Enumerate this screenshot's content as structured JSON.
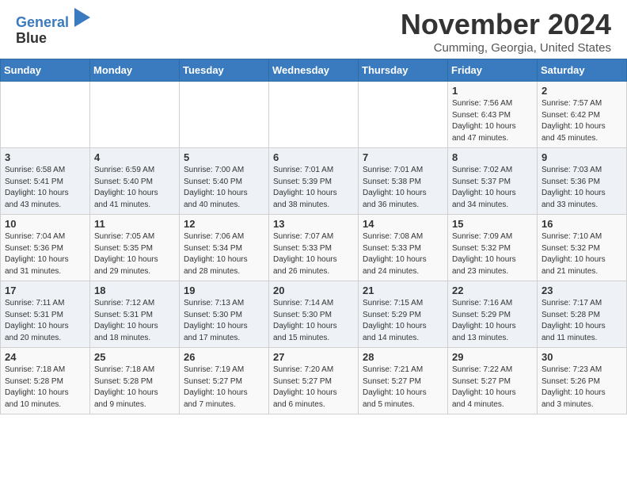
{
  "header": {
    "logo_line1": "General",
    "logo_line2": "Blue",
    "month": "November 2024",
    "location": "Cumming, Georgia, United States"
  },
  "days_of_week": [
    "Sunday",
    "Monday",
    "Tuesday",
    "Wednesday",
    "Thursday",
    "Friday",
    "Saturday"
  ],
  "weeks": [
    [
      {
        "day": "",
        "info": ""
      },
      {
        "day": "",
        "info": ""
      },
      {
        "day": "",
        "info": ""
      },
      {
        "day": "",
        "info": ""
      },
      {
        "day": "",
        "info": ""
      },
      {
        "day": "1",
        "info": "Sunrise: 7:56 AM\nSunset: 6:43 PM\nDaylight: 10 hours\nand 47 minutes."
      },
      {
        "day": "2",
        "info": "Sunrise: 7:57 AM\nSunset: 6:42 PM\nDaylight: 10 hours\nand 45 minutes."
      }
    ],
    [
      {
        "day": "3",
        "info": "Sunrise: 6:58 AM\nSunset: 5:41 PM\nDaylight: 10 hours\nand 43 minutes."
      },
      {
        "day": "4",
        "info": "Sunrise: 6:59 AM\nSunset: 5:40 PM\nDaylight: 10 hours\nand 41 minutes."
      },
      {
        "day": "5",
        "info": "Sunrise: 7:00 AM\nSunset: 5:40 PM\nDaylight: 10 hours\nand 40 minutes."
      },
      {
        "day": "6",
        "info": "Sunrise: 7:01 AM\nSunset: 5:39 PM\nDaylight: 10 hours\nand 38 minutes."
      },
      {
        "day": "7",
        "info": "Sunrise: 7:01 AM\nSunset: 5:38 PM\nDaylight: 10 hours\nand 36 minutes."
      },
      {
        "day": "8",
        "info": "Sunrise: 7:02 AM\nSunset: 5:37 PM\nDaylight: 10 hours\nand 34 minutes."
      },
      {
        "day": "9",
        "info": "Sunrise: 7:03 AM\nSunset: 5:36 PM\nDaylight: 10 hours\nand 33 minutes."
      }
    ],
    [
      {
        "day": "10",
        "info": "Sunrise: 7:04 AM\nSunset: 5:36 PM\nDaylight: 10 hours\nand 31 minutes."
      },
      {
        "day": "11",
        "info": "Sunrise: 7:05 AM\nSunset: 5:35 PM\nDaylight: 10 hours\nand 29 minutes."
      },
      {
        "day": "12",
        "info": "Sunrise: 7:06 AM\nSunset: 5:34 PM\nDaylight: 10 hours\nand 28 minutes."
      },
      {
        "day": "13",
        "info": "Sunrise: 7:07 AM\nSunset: 5:33 PM\nDaylight: 10 hours\nand 26 minutes."
      },
      {
        "day": "14",
        "info": "Sunrise: 7:08 AM\nSunset: 5:33 PM\nDaylight: 10 hours\nand 24 minutes."
      },
      {
        "day": "15",
        "info": "Sunrise: 7:09 AM\nSunset: 5:32 PM\nDaylight: 10 hours\nand 23 minutes."
      },
      {
        "day": "16",
        "info": "Sunrise: 7:10 AM\nSunset: 5:32 PM\nDaylight: 10 hours\nand 21 minutes."
      }
    ],
    [
      {
        "day": "17",
        "info": "Sunrise: 7:11 AM\nSunset: 5:31 PM\nDaylight: 10 hours\nand 20 minutes."
      },
      {
        "day": "18",
        "info": "Sunrise: 7:12 AM\nSunset: 5:31 PM\nDaylight: 10 hours\nand 18 minutes."
      },
      {
        "day": "19",
        "info": "Sunrise: 7:13 AM\nSunset: 5:30 PM\nDaylight: 10 hours\nand 17 minutes."
      },
      {
        "day": "20",
        "info": "Sunrise: 7:14 AM\nSunset: 5:30 PM\nDaylight: 10 hours\nand 15 minutes."
      },
      {
        "day": "21",
        "info": "Sunrise: 7:15 AM\nSunset: 5:29 PM\nDaylight: 10 hours\nand 14 minutes."
      },
      {
        "day": "22",
        "info": "Sunrise: 7:16 AM\nSunset: 5:29 PM\nDaylight: 10 hours\nand 13 minutes."
      },
      {
        "day": "23",
        "info": "Sunrise: 7:17 AM\nSunset: 5:28 PM\nDaylight: 10 hours\nand 11 minutes."
      }
    ],
    [
      {
        "day": "24",
        "info": "Sunrise: 7:18 AM\nSunset: 5:28 PM\nDaylight: 10 hours\nand 10 minutes."
      },
      {
        "day": "25",
        "info": "Sunrise: 7:18 AM\nSunset: 5:28 PM\nDaylight: 10 hours\nand 9 minutes."
      },
      {
        "day": "26",
        "info": "Sunrise: 7:19 AM\nSunset: 5:27 PM\nDaylight: 10 hours\nand 7 minutes."
      },
      {
        "day": "27",
        "info": "Sunrise: 7:20 AM\nSunset: 5:27 PM\nDaylight: 10 hours\nand 6 minutes."
      },
      {
        "day": "28",
        "info": "Sunrise: 7:21 AM\nSunset: 5:27 PM\nDaylight: 10 hours\nand 5 minutes."
      },
      {
        "day": "29",
        "info": "Sunrise: 7:22 AM\nSunset: 5:27 PM\nDaylight: 10 hours\nand 4 minutes."
      },
      {
        "day": "30",
        "info": "Sunrise: 7:23 AM\nSunset: 5:26 PM\nDaylight: 10 hours\nand 3 minutes."
      }
    ]
  ]
}
